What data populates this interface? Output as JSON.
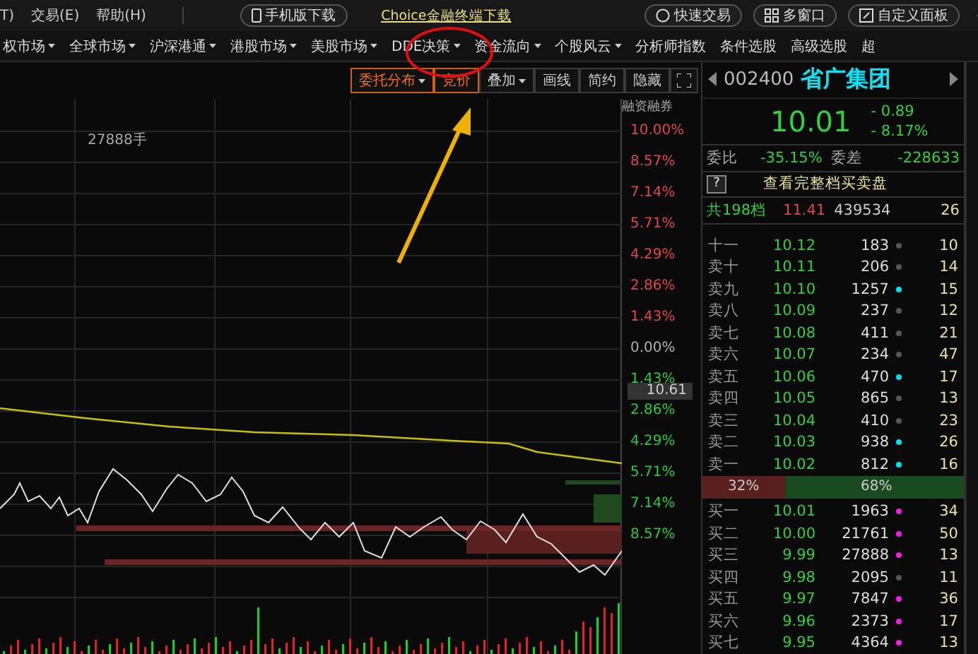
{
  "menu_bar": {
    "items": [
      "T)",
      "交易(E)",
      "帮助(H)"
    ],
    "buttons": [
      {
        "kind": "phone",
        "label": "手机版下载"
      },
      {
        "kind": "link",
        "label": "Choice金融终端下载"
      },
      {
        "kind": "trade",
        "label": "快速交易"
      },
      {
        "kind": "windows",
        "label": "多窗口"
      },
      {
        "kind": "panel",
        "label": "自定义面板"
      }
    ]
  },
  "nav": [
    {
      "label": "权市场",
      "dropdown": true
    },
    {
      "label": "全球市场",
      "dropdown": true
    },
    {
      "label": "沪深港通",
      "dropdown": true
    },
    {
      "label": "港股市场",
      "dropdown": true
    },
    {
      "label": "美股市场",
      "dropdown": true
    },
    {
      "label": "DDE决策",
      "dropdown": true
    },
    {
      "label": "资金流向",
      "dropdown": true
    },
    {
      "label": "个股风云",
      "dropdown": true
    },
    {
      "label": "分析师指数",
      "dropdown": false
    },
    {
      "label": "条件选股",
      "dropdown": false
    },
    {
      "label": "高级选股",
      "dropdown": false
    },
    {
      "label": "超",
      "dropdown": false
    }
  ],
  "toolbar": [
    {
      "label": "委托分布",
      "dropdown": true,
      "selected": true
    },
    {
      "label": "竞价",
      "dropdown": false,
      "selected": true
    },
    {
      "label": "叠加",
      "dropdown": true,
      "selected": false
    },
    {
      "label": "画线",
      "dropdown": false,
      "selected": false
    },
    {
      "label": "简约",
      "dropdown": false,
      "selected": false
    },
    {
      "label": "隐藏",
      "dropdown": false,
      "selected": false
    }
  ],
  "chart": {
    "volume_note": "27888手",
    "overlay_label": "融资融券",
    "price_tag": "10.61",
    "axis_labels": [
      {
        "text": "10.00%",
        "color": "#e04848"
      },
      {
        "text": "8.57%",
        "color": "#e04848"
      },
      {
        "text": "7.14%",
        "color": "#e04848"
      },
      {
        "text": "5.71%",
        "color": "#e04848"
      },
      {
        "text": "4.29%",
        "color": "#e04848"
      },
      {
        "text": "2.86%",
        "color": "#e04848"
      },
      {
        "text": "1.43%",
        "color": "#e04848"
      },
      {
        "text": "0.00%",
        "color": "#b0b0b0"
      },
      {
        "text": "1.43%",
        "color": "#2ec840"
      },
      {
        "text": "2.86%",
        "color": "#2ec840"
      },
      {
        "text": "4.29%",
        "color": "#2ec840"
      },
      {
        "text": "5.71%",
        "color": "#2ec840"
      },
      {
        "text": "7.14%",
        "color": "#2ec840"
      },
      {
        "text": "8.57%",
        "color": "#2ec840"
      }
    ]
  },
  "quote": {
    "code": "002400",
    "name": "省广集团",
    "price": "10.01",
    "change": "- 0.89",
    "change_pct": "- 8.17%",
    "ratio_label": "委比",
    "ratio": "-35.15%",
    "diff_label": "委差",
    "diff": "-228633",
    "help": "?",
    "full_book": "查看完整档买卖盘",
    "total_label": "共198档",
    "total_price": "11.41",
    "total_volume": "439534",
    "total_count": "26"
  },
  "asks": [
    {
      "label": "十一",
      "price": "10.12",
      "volume": "183",
      "color": "#555555",
      "count": "10"
    },
    {
      "label": "卖十",
      "price": "10.11",
      "volume": "206",
      "color": "#555555",
      "count": "14"
    },
    {
      "label": "卖九",
      "price": "10.10",
      "volume": "1257",
      "color": "#00e0f0",
      "count": "15"
    },
    {
      "label": "卖八",
      "price": "10.09",
      "volume": "237",
      "color": "#555555",
      "count": "12"
    },
    {
      "label": "卖七",
      "price": "10.08",
      "volume": "411",
      "color": "#555555",
      "count": "21"
    },
    {
      "label": "卖六",
      "price": "10.07",
      "volume": "234",
      "color": "#555555",
      "count": "47"
    },
    {
      "label": "卖五",
      "price": "10.06",
      "volume": "470",
      "color": "#00e0f0",
      "count": "17"
    },
    {
      "label": "卖四",
      "price": "10.05",
      "volume": "865",
      "color": "#555555",
      "count": "13"
    },
    {
      "label": "卖三",
      "price": "10.04",
      "volume": "410",
      "color": "#555555",
      "count": "23"
    },
    {
      "label": "卖二",
      "price": "10.03",
      "volume": "938",
      "color": "#00e0f0",
      "count": "26"
    },
    {
      "label": "卖一",
      "price": "10.02",
      "volume": "812",
      "color": "#00e0f0",
      "count": "16"
    }
  ],
  "balance": {
    "bid_text": "32%",
    "ask_text": "68%",
    "level": 0.32
  },
  "bids": [
    {
      "label": "买一",
      "price": "10.01",
      "volume": "1963",
      "color": "#f020e0",
      "count": "34"
    },
    {
      "label": "买二",
      "price": "10.00",
      "volume": "21761",
      "color": "#f020e0",
      "count": "50"
    },
    {
      "label": "买三",
      "price": "9.99",
      "volume": "27888",
      "color": "#f020e0",
      "count": "13"
    },
    {
      "label": "买四",
      "price": "9.98",
      "volume": "2095",
      "color": "#555555",
      "count": "11"
    },
    {
      "label": "买五",
      "price": "9.97",
      "volume": "7847",
      "color": "#f020e0",
      "count": "36"
    },
    {
      "label": "买六",
      "price": "9.96",
      "volume": "2373",
      "color": "#f020e0",
      "count": "17"
    },
    {
      "label": "买七",
      "price": "9.95",
      "volume": "4364",
      "color": "#f020e0",
      "count": "13"
    }
  ]
}
